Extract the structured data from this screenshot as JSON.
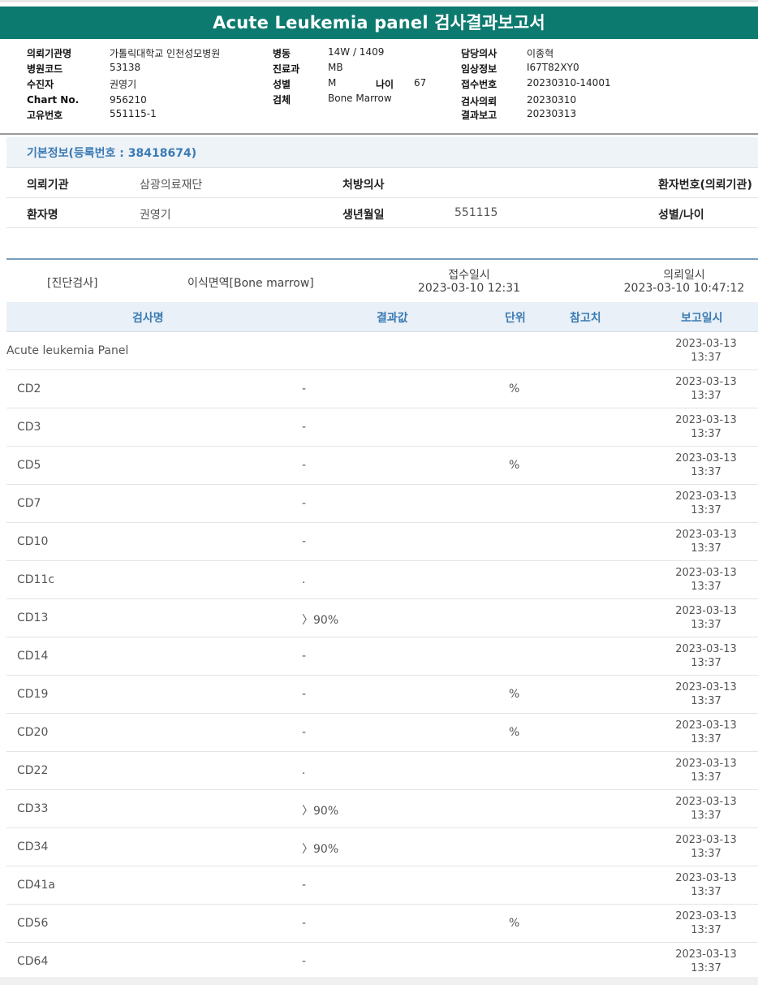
{
  "title": "Acute Leukemia panel 검사결과보고서",
  "report_header": {
    "col1": [
      {
        "label": "의뢰기관명",
        "value": "가톨릭대학교 인천성모병원"
      },
      {
        "label": "병원코드",
        "value": "53138"
      },
      {
        "label": "수진자",
        "value": "권영기"
      },
      {
        "label": "Chart No.",
        "value": "956210"
      },
      {
        "label": "고유번호",
        "value": "551115-1"
      }
    ],
    "col2": [
      {
        "label": "병동",
        "value": "14W / 1409"
      },
      {
        "label": "진료과",
        "value": "MB"
      },
      {
        "label": "성별",
        "value": "M"
      },
      {
        "label": "검체",
        "value": "Bone Marrow"
      }
    ],
    "age": {
      "label": "나이",
      "value": "67"
    },
    "col3": [
      {
        "label": "담당의사",
        "value": "이종혁"
      },
      {
        "label": "임상정보",
        "value": "I67T82XY0"
      },
      {
        "label": "접수번호",
        "value": "20230310-14001"
      },
      {
        "label": "검사의뢰",
        "value": "20230310"
      },
      {
        "label": "결과보고",
        "value": "20230313"
      }
    ]
  },
  "basic_info": {
    "heading": "기본정보(등록번호 : 38418674)",
    "row1": {
      "inst_label": "의뢰기관",
      "inst_value": "삼광의료재단",
      "doctor_label": "처방의사",
      "patno_label": "환자번호(의뢰기관)"
    },
    "row2": {
      "name_label": "환자명",
      "name_value": "권영기",
      "dob_label": "생년월일",
      "dob_value": "551115",
      "sexage_label": "성별/나이"
    }
  },
  "diagnosis": {
    "category": "[진단검사]",
    "test": "이식면역[Bone marrow]",
    "received_label": "접수일시",
    "received_value": "2023-03-10 12:31",
    "requested_label": "의뢰일시",
    "requested_value": "2023-03-10 10:47:12"
  },
  "table": {
    "headers": {
      "name": "검사명",
      "result": "결과값",
      "unit": "단위",
      "ref": "참고치",
      "date": "보고일시"
    },
    "panel": {
      "name": "Acute leukemia Panel",
      "date": "2023-03-13",
      "time": "13:37"
    },
    "rows": [
      {
        "name": "CD2",
        "result": "-",
        "unit": "%",
        "date": "2023-03-13",
        "time": "13:37"
      },
      {
        "name": "CD3",
        "result": "-",
        "unit": "",
        "date": "2023-03-13",
        "time": "13:37"
      },
      {
        "name": "CD5",
        "result": "-",
        "unit": "%",
        "date": "2023-03-13",
        "time": "13:37"
      },
      {
        "name": "CD7",
        "result": "-",
        "unit": "",
        "date": "2023-03-13",
        "time": "13:37"
      },
      {
        "name": "CD10",
        "result": "-",
        "unit": "",
        "date": "2023-03-13",
        "time": "13:37"
      },
      {
        "name": "CD11c",
        "result": ".",
        "unit": "",
        "date": "2023-03-13",
        "time": "13:37"
      },
      {
        "name": "CD13",
        "result": "〉90%",
        "unit": "",
        "date": "2023-03-13",
        "time": "13:37"
      },
      {
        "name": "CD14",
        "result": "-",
        "unit": "",
        "date": "2023-03-13",
        "time": "13:37"
      },
      {
        "name": "CD19",
        "result": "-",
        "unit": "%",
        "date": "2023-03-13",
        "time": "13:37"
      },
      {
        "name": "CD20",
        "result": "-",
        "unit": "%",
        "date": "2023-03-13",
        "time": "13:37"
      },
      {
        "name": "CD22",
        "result": ".",
        "unit": "",
        "date": "2023-03-13",
        "time": "13:37"
      },
      {
        "name": "CD33",
        "result": "〉90%",
        "unit": "",
        "date": "2023-03-13",
        "time": "13:37"
      },
      {
        "name": "CD34",
        "result": "〉90%",
        "unit": "",
        "date": "2023-03-13",
        "time": "13:37"
      },
      {
        "name": "CD41a",
        "result": "-",
        "unit": "",
        "date": "2023-03-13",
        "time": "13:37"
      },
      {
        "name": "CD56",
        "result": "-",
        "unit": "%",
        "date": "2023-03-13",
        "time": "13:37"
      },
      {
        "name": "CD64",
        "result": "-",
        "unit": "",
        "date": "2023-03-13",
        "time": "13:37"
      }
    ]
  }
}
